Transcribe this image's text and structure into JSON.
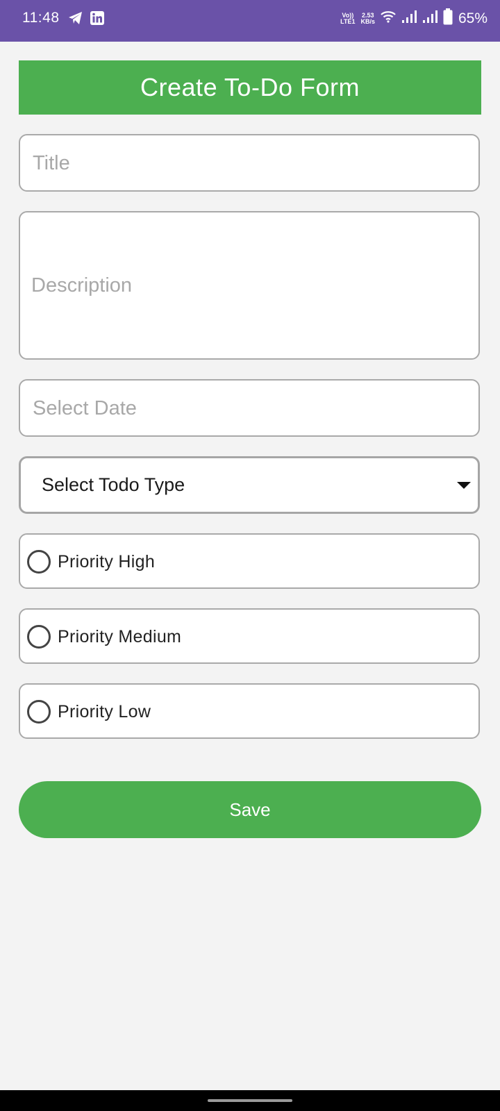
{
  "status_bar": {
    "time": "11:48",
    "network_top": "Vo))",
    "network_bottom": "LTE1",
    "speed_top": "2.53",
    "speed_bottom": "KB/s",
    "battery": "65%",
    "icons": [
      "telegram-icon",
      "linkedin-icon",
      "wifi-icon",
      "signal-icon",
      "signal-icon",
      "battery-icon"
    ]
  },
  "header": {
    "title": "Create To-Do Form"
  },
  "form": {
    "title_placeholder": "Title",
    "title_value": "",
    "description_placeholder": "Description",
    "date_placeholder": "Select Date",
    "type_select": "Select Todo Type",
    "priorities": [
      {
        "label": "Priority High",
        "selected": false
      },
      {
        "label": "Priority Medium",
        "selected": false
      },
      {
        "label": "Priority Low",
        "selected": false
      }
    ],
    "save_label": "Save"
  },
  "colors": {
    "status_bar": "#6a52a8",
    "accent_green": "#4caf50",
    "background": "#f3f3f3"
  }
}
